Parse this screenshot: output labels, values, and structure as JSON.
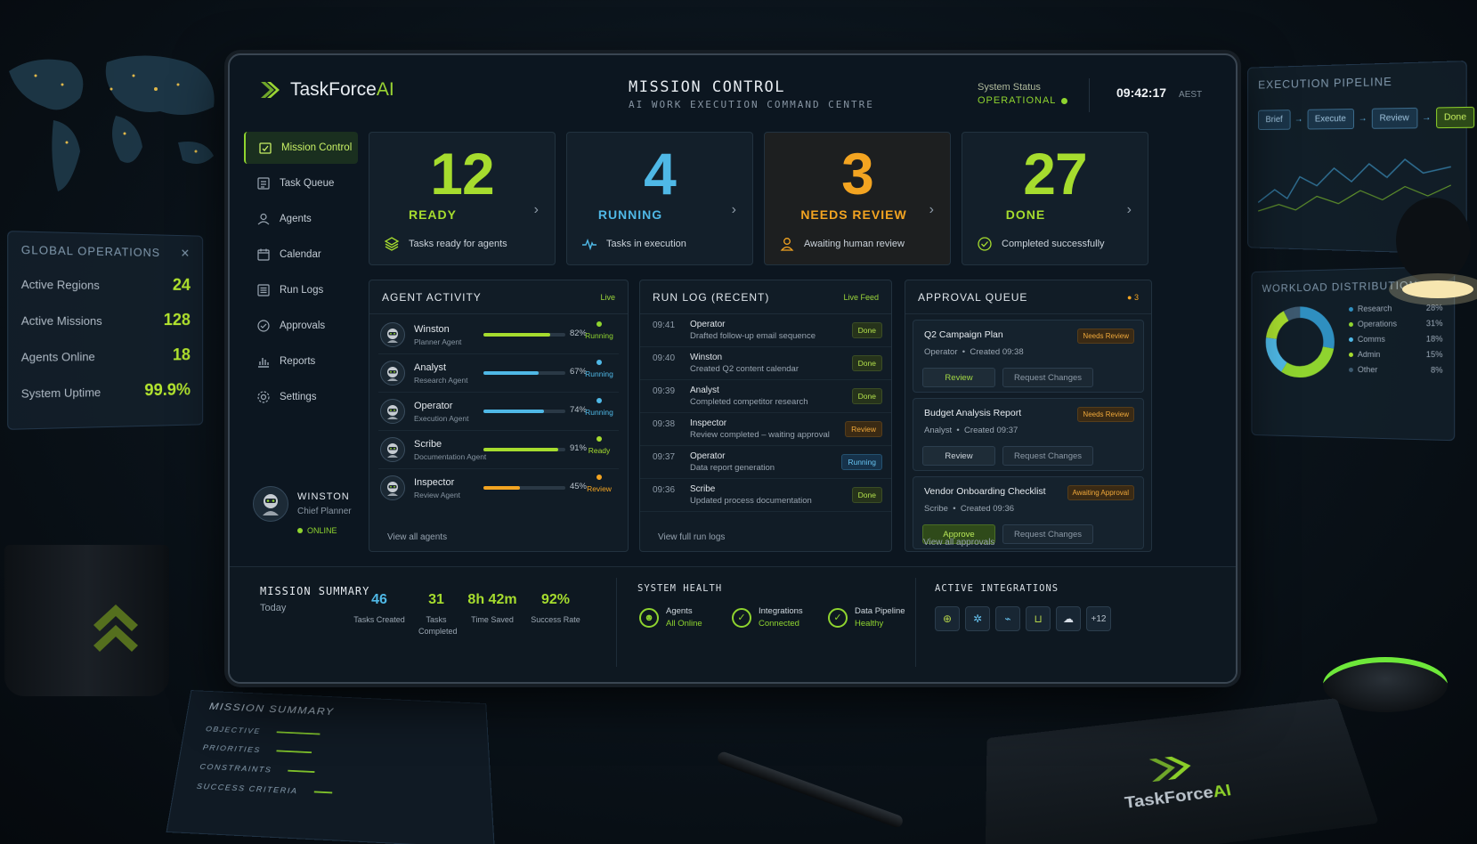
{
  "background": {
    "global_ops": {
      "title": "GLOBAL OPERATIONS",
      "rows": [
        {
          "label": "Active Regions",
          "value": "24"
        },
        {
          "label": "Active Missions",
          "value": "128"
        },
        {
          "label": "Agents Online",
          "value": "18"
        },
        {
          "label": "System Uptime",
          "value": "99.9%"
        }
      ]
    },
    "pipeline": {
      "title": "EXECUTION PIPELINE",
      "steps": [
        "Brief",
        "Execute",
        "Review",
        "Done"
      ]
    },
    "workload": {
      "title": "WORKLOAD DISTRIBUTION",
      "items": [
        {
          "label": "Research",
          "value": "28%",
          "color": "#2f8fc0"
        },
        {
          "label": "Operations",
          "value": "31%",
          "color": "#8fd42f"
        },
        {
          "label": "Comms",
          "value": "18%",
          "color": "#4fb8e6"
        },
        {
          "label": "Admin",
          "value": "15%",
          "color": "#a6dc2e"
        },
        {
          "label": "Other",
          "value": "8%",
          "color": "#3d5a70"
        }
      ]
    },
    "paper": {
      "title": "MISSION SUMMARY",
      "lines": [
        "OBJECTIVE",
        "PRIORITIES",
        "CONSTRAINTS",
        "SUCCESS CRITERIA"
      ]
    },
    "notebook_logo": {
      "prefix": "TaskForce",
      "suffix": "AI"
    }
  },
  "header": {
    "logo_prefix": "TaskForce",
    "logo_suffix": "AI",
    "title": "MISSION CONTROL",
    "subtitle": "AI WORK EXECUTION COMMAND CENTRE",
    "status_label": "System Status",
    "status_value": "OPERATIONAL",
    "time": "09:42:17",
    "timezone": "AEST"
  },
  "sidebar": {
    "items": [
      {
        "label": "Mission Control",
        "icon": "mission-control-icon"
      },
      {
        "label": "Task Queue",
        "icon": "task-queue-icon"
      },
      {
        "label": "Agents",
        "icon": "agents-icon"
      },
      {
        "label": "Calendar",
        "icon": "calendar-icon"
      },
      {
        "label": "Run Logs",
        "icon": "run-logs-icon"
      },
      {
        "label": "Approvals",
        "icon": "approvals-icon"
      },
      {
        "label": "Reports",
        "icon": "reports-icon"
      },
      {
        "label": "Settings",
        "icon": "settings-icon"
      }
    ],
    "profile": {
      "name": "WINSTON",
      "role": "Chief Planner",
      "status": "ONLINE"
    }
  },
  "stats": [
    {
      "value": "12",
      "label": "READY",
      "sub": "Tasks ready for agents",
      "color": "#a6dc2e"
    },
    {
      "value": "4",
      "label": "RUNNING",
      "sub": "Tasks in execution",
      "color": "#4fb8e6"
    },
    {
      "value": "3",
      "label": "NEEDS REVIEW",
      "sub": "Awaiting human review",
      "color": "#f3a421"
    },
    {
      "value": "27",
      "label": "DONE",
      "sub": "Completed successfully",
      "color": "#a6dc2e"
    }
  ],
  "agent_activity": {
    "title": "AGENT ACTIVITY",
    "badge": "Live",
    "footer": "View all agents",
    "agents": [
      {
        "name": "Winston",
        "role": "Planner Agent",
        "progress": 0.82,
        "pct": "82%",
        "status": "Running",
        "color": "#a6dc2e",
        "status_color": "#8fd42f"
      },
      {
        "name": "Analyst",
        "role": "Research Agent",
        "progress": 0.67,
        "pct": "67%",
        "status": "Running",
        "color": "#4fb8e6",
        "status_color": "#4fb8e6"
      },
      {
        "name": "Operator",
        "role": "Execution Agent",
        "progress": 0.74,
        "pct": "74%",
        "status": "Running",
        "color": "#4fb8e6",
        "status_color": "#4fb8e6"
      },
      {
        "name": "Scribe",
        "role": "Documentation Agent",
        "progress": 0.91,
        "pct": "91%",
        "status": "Ready",
        "color": "#a6dc2e",
        "status_color": "#a6dc2e"
      },
      {
        "name": "Inspector",
        "role": "Review Agent",
        "progress": 0.45,
        "pct": "45%",
        "status": "Review",
        "color": "#f3a421",
        "status_color": "#f3a421"
      }
    ]
  },
  "run_log": {
    "title": "RUN LOG (RECENT)",
    "badge": "Live Feed",
    "footer": "View full run logs",
    "entries": [
      {
        "time": "09:41",
        "agent": "Operator",
        "desc": "Drafted follow-up email sequence",
        "status": "Done",
        "kind": "done"
      },
      {
        "time": "09:40",
        "agent": "Winston",
        "desc": "Created Q2 content calendar",
        "status": "Done",
        "kind": "done"
      },
      {
        "time": "09:39",
        "agent": "Analyst",
        "desc": "Completed competitor research",
        "status": "Done",
        "kind": "done"
      },
      {
        "time": "09:38",
        "agent": "Inspector",
        "desc": "Review completed – waiting approval",
        "status": "Review",
        "kind": "review"
      },
      {
        "time": "09:37",
        "agent": "Operator",
        "desc": "Data report generation",
        "status": "Running",
        "kind": "running"
      },
      {
        "time": "09:36",
        "agent": "Scribe",
        "desc": "Updated process documentation",
        "status": "Done",
        "kind": "done"
      }
    ]
  },
  "approval_queue": {
    "title": "APPROVAL QUEUE",
    "count": "3",
    "footer": "View all approvals",
    "items": [
      {
        "title": "Q2 Campaign Plan",
        "agent": "Operator",
        "created": "Created 09:38",
        "tag": "Needs Review",
        "primary": "Review",
        "secondary": "Request Changes",
        "kind": "review"
      },
      {
        "title": "Budget Analysis Report",
        "agent": "Analyst",
        "created": "Created 09:37",
        "tag": "Needs Review",
        "primary": "Review",
        "secondary": "Request Changes",
        "kind": "plain"
      },
      {
        "title": "Vendor Onboarding Checklist",
        "agent": "Scribe",
        "created": "Created 09:36",
        "tag": "Awaiting Approval",
        "primary": "Approve",
        "secondary": "Request Changes",
        "kind": "approve"
      }
    ]
  },
  "mission_summary": {
    "title": "MISSION SUMMARY",
    "sub": "Today",
    "stats": [
      {
        "value": "46",
        "label": "Tasks Created",
        "color": "#4fb8e6"
      },
      {
        "value": "31",
        "label": "Tasks Completed",
        "color": "#a6dc2e"
      },
      {
        "value": "8h 42m",
        "label": "Time Saved",
        "color": "#a6dc2e"
      },
      {
        "value": "92%",
        "label": "Success Rate",
        "color": "#a6dc2e"
      }
    ]
  },
  "system_health": {
    "title": "SYSTEM HEALTH",
    "items": [
      {
        "label": "Agents",
        "value": "All Online"
      },
      {
        "label": "Integrations",
        "value": "Connected"
      },
      {
        "label": "Data Pipeline",
        "value": "Healthy"
      }
    ]
  },
  "integrations": {
    "title": "ACTIVE INTEGRATIONS",
    "icons": [
      "plus-circle-icon",
      "gear-cluster-icon",
      "link-icon",
      "basket-icon",
      "cloud-icon"
    ],
    "more": "+12"
  }
}
